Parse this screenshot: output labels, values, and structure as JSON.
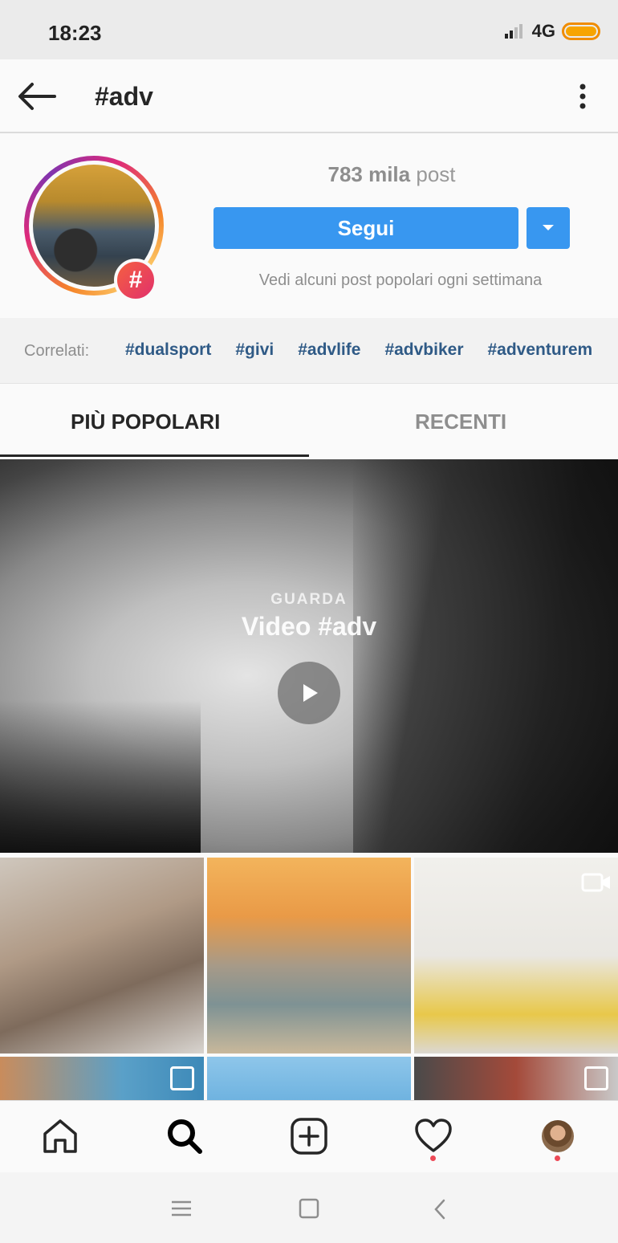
{
  "status_bar": {
    "time": "18:23",
    "network": "4G",
    "accent": "#f7a400"
  },
  "header": {
    "title": "#adv",
    "back_icon": "arrow-left-icon",
    "more_icon": "more-vertical-icon"
  },
  "profile": {
    "post_count_number": "783 mila",
    "post_count_word": "post",
    "follow_label": "Segui",
    "hint": "Vedi alcuni post popolari ogni settimana",
    "badge": "#",
    "follow_color": "#3897f0"
  },
  "related": {
    "label": "Correlati:",
    "tags": [
      "#dualsport",
      "#givi",
      "#advlife",
      "#advbiker",
      "#adventurem"
    ]
  },
  "tabs": {
    "popular": "PIÙ POPOLARI",
    "recent": "RECENTI",
    "active": "popular"
  },
  "video": {
    "subtitle": "GUARDA",
    "title": "Video #adv"
  },
  "bottom_nav": [
    "home-icon",
    "search-icon",
    "add-post-icon",
    "activity-heart-icon",
    "profile-avatar"
  ]
}
